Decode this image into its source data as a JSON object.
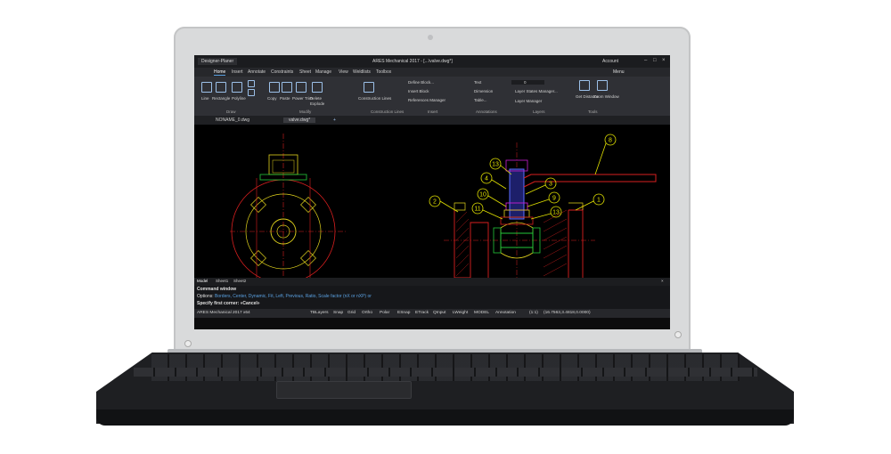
{
  "window": {
    "app_menu": "Designer-Planer",
    "title": "ARES Mechanical 2017 - [...\\valve.dwg*]",
    "account": "Account",
    "menu": "Menu"
  },
  "ribbon_tabs": [
    "Home",
    "Insert",
    "Annotate",
    "Constraints",
    "Sheet",
    "Manage",
    "View",
    "Weldlists",
    "Toolbox"
  ],
  "ribbon": {
    "draw": {
      "line": "Line",
      "rectangle": "Rectangle",
      "polyline": "Polyline",
      "group": "Draw"
    },
    "modify": {
      "copy": "Copy",
      "paste": "Paste",
      "power_trim": "Power Trim",
      "delete": "Delete",
      "explode": "Explode",
      "group": "Modify"
    },
    "construction": {
      "lines": "Construction Lines",
      "group": "Construction Lines"
    },
    "insert": {
      "define_block": "Define Block...",
      "insert_block": "Insert Block",
      "ref_manager": "References Manager",
      "group": "Insert"
    },
    "annotations": {
      "text": "Text",
      "dimension": "Dimension",
      "table": "Table...",
      "group": "Annotations"
    },
    "layers": {
      "layer_name": "0",
      "states": "Layer States Manager...",
      "manager": "Layer Manager",
      "group": "Layers"
    },
    "tools": {
      "get_distance": "Get Distance",
      "zoom_window": "Zoom Window",
      "group": "Tools"
    }
  },
  "doc_tabs": [
    "NONAME_0.dwg",
    "valve.dwg*"
  ],
  "drawing": {
    "balloons": [
      "13",
      "4",
      "10",
      "11",
      "2",
      "8",
      "3",
      "9",
      "13",
      "1"
    ]
  },
  "model_tabs": [
    "Model",
    "Sheet1",
    "Sheet2"
  ],
  "command": {
    "window_label": "Command window",
    "options_prefix": "Options:",
    "options": "Borders, Center, Dynamic, Fit, Left, Previous, Ratio, Scale factor (nX or nXP) or",
    "prompt": "Specify first corner: «Cancel»"
  },
  "status": {
    "version": "ARES Mechanical 2017 x64",
    "toggles": [
      "TBLayers",
      "Snap",
      "Grid",
      "Ortho",
      "Polar",
      "ESnap",
      "ETrack",
      "QInput",
      "LWeight",
      "MODEL",
      "Annotation"
    ],
    "scale": "(1:1)",
    "coords": "(16.7563,3.4818,0.0000)"
  },
  "colors": {
    "balloon": "#e3e300",
    "drawing_red": "#d91f1f",
    "drawing_yellow": "#e0d21c",
    "drawing_green": "#24c93a",
    "drawing_blue": "#5a6cff",
    "drawing_magenta": "#c81ed0"
  }
}
